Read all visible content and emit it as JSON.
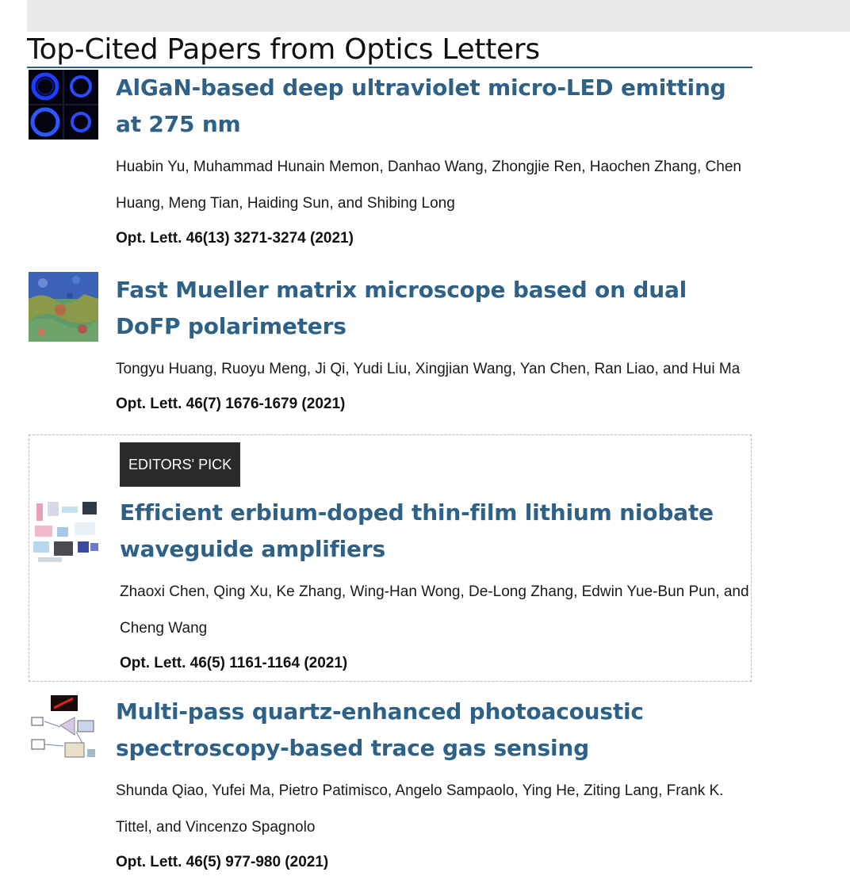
{
  "section": {
    "title": "Top-Cited Papers from Optics Letters"
  },
  "papers": [
    {
      "title": "AlGaN-based deep ultraviolet micro-LED emitting at 275 nm",
      "authors": "Huabin Yu, Muhammad Hunain Memon, Danhao Wang, Zhongjie Ren, Haochen Zhang, Chen Huang, Meng Tian, Haiding Sun, and Shibing Long",
      "citation": "Opt. Lett. 46(13) 3271-3274 (2021)",
      "thumbnail": "blue-rings-thumbnail"
    },
    {
      "title": "Fast Mueller matrix microscope based on dual DoFP polarimeters",
      "authors": "Tongyu Huang, Ruoyu Meng, Ji Qi, Yudi Liu, Xingjian Wang, Yan Chen, Ran Liao, and Hui Ma",
      "citation": "Opt. Lett. 46(7) 1676-1679 (2021)",
      "thumbnail": "microscope-map-thumbnail"
    },
    {
      "badge": "EDITORS' PICK",
      "title": "Efficient erbium-doped thin-film lithium niobate waveguide amplifiers",
      "authors": "Zhaoxi Chen, Qing Xu, Ke Zhang, Wing-Han Wong, De-Long Zhang, Edwin Yue-Bun Pun, and Cheng Wang",
      "citation": "Opt. Lett. 46(5) 1161-1164 (2021)",
      "thumbnail": "waveguide-setup-thumbnail"
    },
    {
      "title": "Multi-pass quartz-enhanced photoacoustic spectroscopy-based trace gas sensing",
      "authors": "Shunda Qiao, Yufei Ma, Pietro Patimisco, Angelo Sampaolo, Ying He, Ziting Lang, Frank K. Tittel, and Vincenzo Spagnolo",
      "citation": "Opt. Lett. 46(5) 977-980 (2021)",
      "thumbnail": "photoacoustic-setup-thumbnail"
    }
  ]
}
